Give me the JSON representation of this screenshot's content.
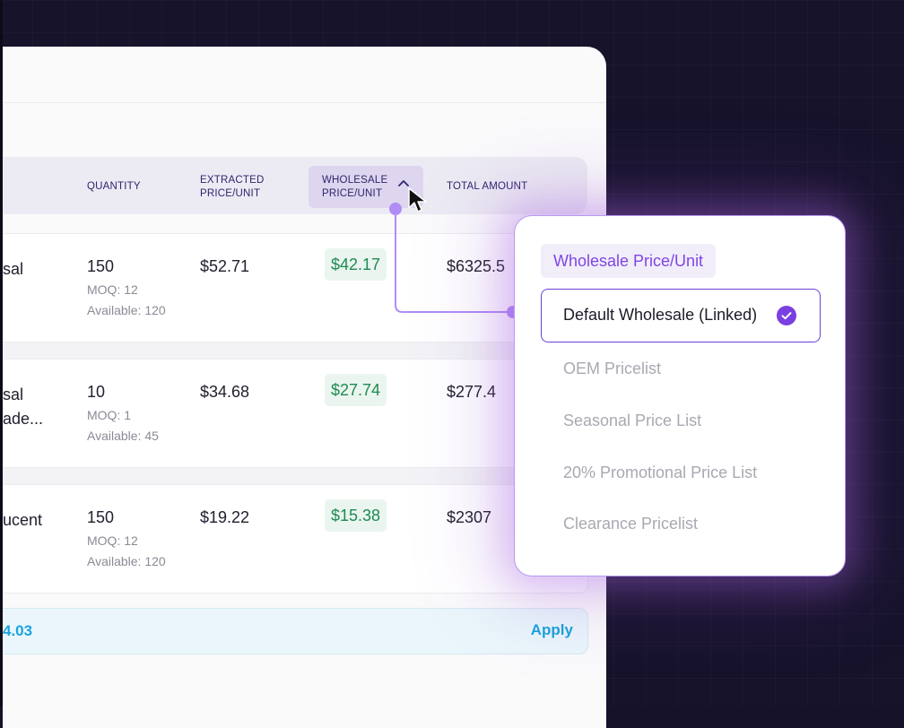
{
  "table": {
    "headers": {
      "quantity": "QUANTITY",
      "extracted_line1": "EXTRACTED",
      "extracted_line2": "PRICE/UNIT",
      "wholesale_line1": "WHOLESALE",
      "wholesale_line2": "PRICE/UNIT",
      "total": "TOTAL AMOUNT"
    },
    "rows": [
      {
        "name_line1": "sal",
        "name_line2": "",
        "quantity": "150",
        "moq": "MOQ: 12",
        "available": "Available: 120",
        "extracted": "$52.71",
        "wholesale": "$42.17",
        "total": "$6325.5"
      },
      {
        "name_line1": "sal",
        "name_line2": "ade...",
        "quantity": "10",
        "moq": "MOQ: 1",
        "available": "Available: 45",
        "extracted": "$34.68",
        "wholesale": "$27.74",
        "total": "$277.4"
      },
      {
        "name_line1": "ucent",
        "name_line2": "",
        "quantity": "150",
        "moq": "MOQ: 12",
        "available": "Available: 120",
        "extracted": "$19.22",
        "wholesale": "$15.38",
        "total": "$2307"
      }
    ]
  },
  "footer": {
    "total": "4.03",
    "apply_label": "Apply"
  },
  "dropdown": {
    "header": "Wholesale Price/Unit",
    "selected": "Default Wholesale (Linked)",
    "options": [
      "OEM Pricelist",
      "Seasonal Price List",
      "20% Promotional Price List",
      "Clearance Pricelist"
    ]
  },
  "colors": {
    "accent": "#8045e6",
    "selected_border": "#6b3fd6",
    "price_green": "#1f8a52",
    "link_blue": "#1aa3dc",
    "connector": "#b08cf5"
  },
  "icons": {
    "sort": "chevron-up-icon",
    "check": "check-circle-icon",
    "cursor": "mouse-pointer-icon"
  }
}
